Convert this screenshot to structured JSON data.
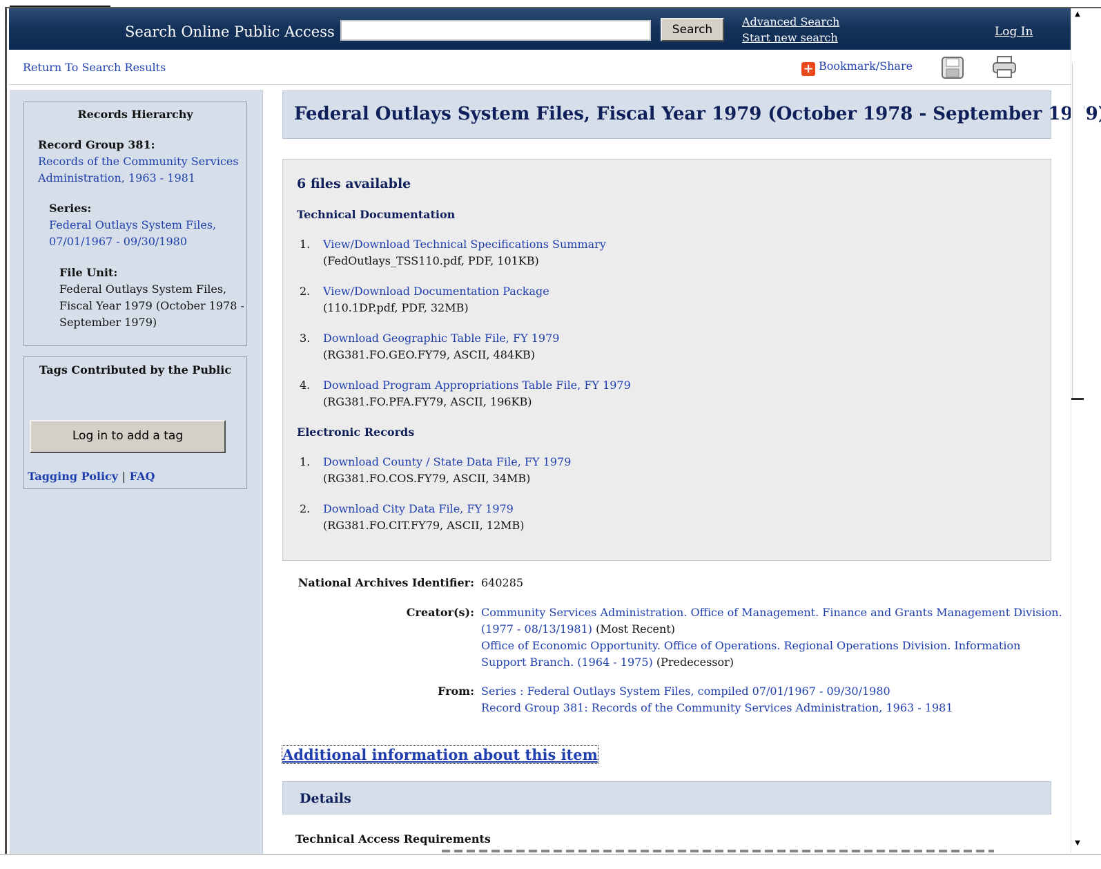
{
  "header": {
    "title": "Search Online Public Access",
    "search_value": "",
    "search_button": "Search",
    "advanced_search": "Advanced Search",
    "new_search": "Start new search",
    "login": "Log In"
  },
  "toolbar": {
    "return_link": "Return To Search Results",
    "bookmark": "Bookmark/Share",
    "save_icon": "floppy-disk-icon",
    "print_icon": "printer-icon"
  },
  "hierarchy": {
    "title": "Records Hierarchy",
    "record_group_label": "Record Group 381:",
    "record_group_link_1": "Records of the Community Services",
    "record_group_link_2": "Administration, 1963 - 1981",
    "series_label": "Series:",
    "series_link_1": "Federal Outlays System Files,",
    "series_link_2": "07/01/1967 - 09/30/1980",
    "file_unit_label": "File Unit:",
    "file_unit_1": "Federal Outlays System Files,",
    "file_unit_2": "Fiscal Year 1979 (October 1978 -",
    "file_unit_3": "September 1979)"
  },
  "tags": {
    "title": "Tags Contributed by the Public",
    "button": "Log in to add a tag",
    "policy": "Tagging Policy",
    "separator": "|",
    "faq": "FAQ"
  },
  "main": {
    "title": "Federal Outlays System Files, Fiscal Year 1979 (October 1978 - September 1979)",
    "files_count": "6 files available",
    "tech_doc_heading": "Technical Documentation",
    "tech_docs": [
      {
        "num": "1.",
        "link": "View/Download Technical Specifications Summary",
        "meta": "(FedOutlays_TSS110.pdf, PDF, 101KB)"
      },
      {
        "num": "2.",
        "link": "View/Download Documentation Package",
        "meta": "(110.1DP.pdf, PDF, 32MB)"
      },
      {
        "num": "3.",
        "link": "Download Geographic Table File, FY 1979",
        "meta": "(RG381.FO.GEO.FY79, ASCII, 484KB)"
      },
      {
        "num": "4.",
        "link": "Download Program Appropriations Table File, FY 1979",
        "meta": "(RG381.FO.PFA.FY79, ASCII, 196KB)"
      }
    ],
    "electronic_heading": "Electronic Records",
    "electronic": [
      {
        "num": "1.",
        "link": "Download County / State Data File, FY 1979",
        "meta": "(RG381.FO.COS.FY79, ASCII, 34MB)"
      },
      {
        "num": "2.",
        "link": "Download City Data File, FY 1979",
        "meta": "(RG381.FO.CIT.FY79, ASCII, 12MB)"
      }
    ],
    "nai_label": "National Archives Identifier:",
    "nai_value": "640285",
    "creators_label": "Creator(s):",
    "creator_1_line1": "Community Services Administration. Office of Management. Finance and Grants Management Division.",
    "creator_1_line2": "(1977 - 08/13/1981)",
    "creator_1_role": "(Most Recent)",
    "creator_2_line1": "Office of Economic Opportunity. Office of Operations. Regional Operations Division. Information",
    "creator_2_line2": "Support Branch. (1964 - 1975)",
    "creator_2_role": "(Predecessor)",
    "from_label": "From:",
    "from_1": "Series : Federal Outlays System Files, compiled 07/01/1967 - 09/30/1980",
    "from_2": "Record Group 381: Records of the Community Services Administration, 1963 - 1981",
    "additional": "Additional information about this item",
    "details": "Details",
    "tech_access": "Technical Access Requirements"
  }
}
